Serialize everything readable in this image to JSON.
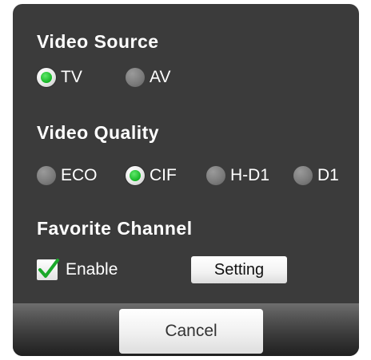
{
  "video_source": {
    "title": "Video Source",
    "options": [
      {
        "label": "TV",
        "selected": true
      },
      {
        "label": "AV",
        "selected": false
      }
    ]
  },
  "video_quality": {
    "title": "Video Quality",
    "options": [
      {
        "label": "ECO",
        "selected": false
      },
      {
        "label": "CIF",
        "selected": true
      },
      {
        "label": "H-D1",
        "selected": false
      },
      {
        "label": "D1",
        "selected": false
      }
    ]
  },
  "favorite_channel": {
    "title": "Favorite Channel",
    "enable_label": "Enable",
    "enabled": true,
    "setting_label": "Setting"
  },
  "footer": {
    "cancel_label": "Cancel"
  },
  "colors": {
    "panel": "#3b3b3b",
    "accent_green": "#16b526",
    "text": "#ffffff"
  }
}
